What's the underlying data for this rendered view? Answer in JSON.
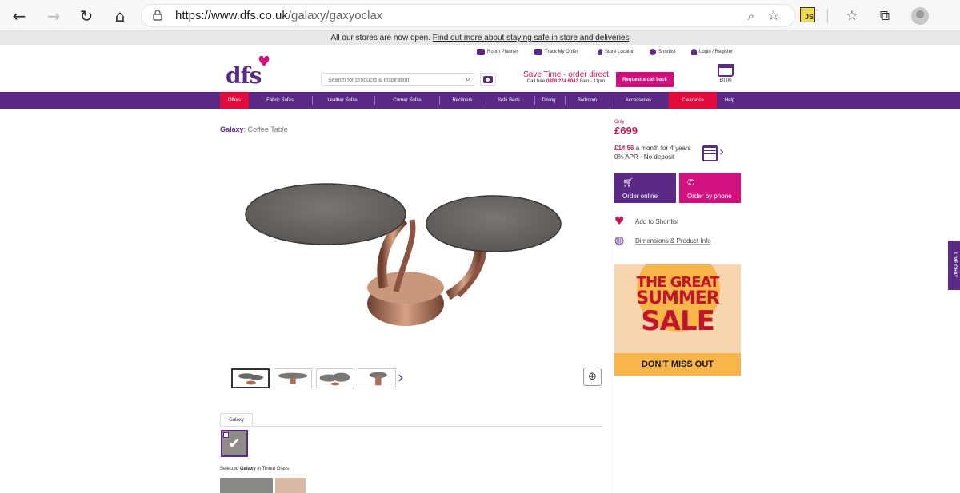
{
  "browser": {
    "url_host": "https://www.dfs.co.uk",
    "url_path": "/galaxy/gaxyoclax",
    "icons": [
      "back-icon",
      "forward-icon",
      "refresh-icon",
      "home-icon",
      "lock-icon",
      "zoom-icon",
      "favorite-icon",
      "js-extension-icon",
      "favorites-icon",
      "collections-icon",
      "profile-icon"
    ],
    "ext_label": "JS"
  },
  "notice": {
    "text": "All our stores are now open.",
    "link": "Find out more about staying safe in store and deliveries"
  },
  "utility": {
    "room_planner": "Room Planner",
    "track_order": "Track My Order",
    "store_locator": "Store Locator",
    "shortlist": "Shortlist",
    "login": "Login / Register"
  },
  "header": {
    "logo": "dfs",
    "search_placeholder": "Search for products & inspiration",
    "save_time": "Save Time - order direct",
    "call_free": "Call free",
    "phone": "0808 274 6043",
    "hours": "8am - 11pm",
    "callback": "Request a call back",
    "basket_total": "£0.00"
  },
  "nav": {
    "items": [
      "Offers",
      "Fabric Sofas",
      "Leather Sofas",
      "Corner Sofas",
      "Recliners",
      "Sofa Beds",
      "Dining",
      "Bedroom",
      "Accessories",
      "Clearance",
      "Help"
    ],
    "highlight_color": "#e30a3c",
    "bar_color": "#5b2a86"
  },
  "product": {
    "brand": "Galaxy",
    "name": "Coffee Table",
    "tab": "Galaxy",
    "selected_prefix": "Selected",
    "selected_name": "Galaxy",
    "selected_suffix": "in Tinted Glass"
  },
  "pricing": {
    "only": "Only",
    "price": "£699",
    "monthly": "£14.56",
    "monthly_text": "a month for 4 years",
    "apr": "0% APR - No deposit"
  },
  "actions": {
    "order_online": "Order online",
    "order_phone": "Order by phone",
    "add_shortlist": "Add to Shortlist",
    "dimensions": "Dimensions & Product Info"
  },
  "promo": {
    "line1": "THE GREAT",
    "line2": "SUMMER",
    "line3": "SALE",
    "cta": "DON'T MISS OUT"
  },
  "live_chat": "LIVE CHAT"
}
